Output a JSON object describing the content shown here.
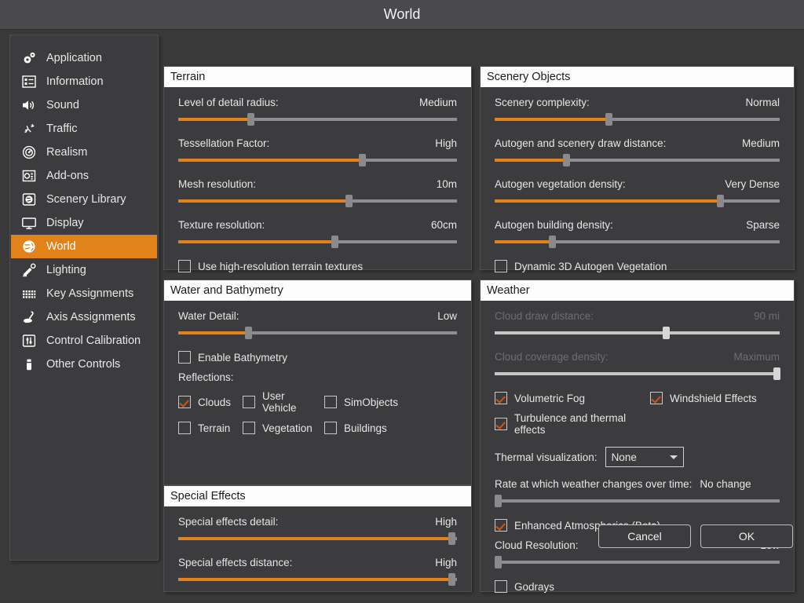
{
  "window": {
    "title": "World"
  },
  "sidebar": {
    "items": [
      {
        "label": "Application",
        "icon": "gears-icon",
        "active": false
      },
      {
        "label": "Information",
        "icon": "list-icon",
        "active": false
      },
      {
        "label": "Sound",
        "icon": "speaker-icon",
        "active": false
      },
      {
        "label": "Traffic",
        "icon": "airplanes-icon",
        "active": false
      },
      {
        "label": "Realism",
        "icon": "gauge-icon",
        "active": false
      },
      {
        "label": "Add-ons",
        "icon": "addons-box-icon",
        "active": false
      },
      {
        "label": "Scenery Library",
        "icon": "globe-box-icon",
        "active": false
      },
      {
        "label": "Display",
        "icon": "monitor-icon",
        "active": false
      },
      {
        "label": "World",
        "icon": "globe-icon",
        "active": true
      },
      {
        "label": "Lighting",
        "icon": "lamp-icon",
        "active": false
      },
      {
        "label": "Key Assignments",
        "icon": "keyboard-icon",
        "active": false
      },
      {
        "label": "Axis Assignments",
        "icon": "joystick-icon",
        "active": false
      },
      {
        "label": "Control Calibration",
        "icon": "sliders-box-icon",
        "active": false
      },
      {
        "label": "Other Controls",
        "icon": "device-icon",
        "active": false
      }
    ]
  },
  "terrain": {
    "title": "Terrain",
    "sliders": [
      {
        "label": "Level of detail radius:",
        "value": "Medium",
        "pct": 26
      },
      {
        "label": "Tessellation Factor:",
        "value": "High",
        "pct": 66
      },
      {
        "label": "Mesh resolution:",
        "value": "10m",
        "pct": 61
      },
      {
        "label": "Texture resolution:",
        "value": "60cm",
        "pct": 56
      }
    ],
    "checkbox": {
      "label": "Use high-resolution terrain textures",
      "checked": false
    }
  },
  "scenery": {
    "title": "Scenery Objects",
    "sliders": [
      {
        "label": "Scenery complexity:",
        "value": "Normal",
        "pct": 40
      },
      {
        "label": "Autogen and scenery draw distance:",
        "value": "Medium",
        "pct": 25
      },
      {
        "label": "Autogen vegetation density:",
        "value": "Very Dense",
        "pct": 79
      },
      {
        "label": "Autogen building density:",
        "value": "Sparse",
        "pct": 20
      }
    ],
    "checkbox": {
      "label": "Dynamic 3D Autogen Vegetation",
      "checked": false
    }
  },
  "water": {
    "title": "Water and Bathymetry",
    "slider": {
      "label": "Water Detail:",
      "value": "Low",
      "pct": 25
    },
    "bathymetry": {
      "label": "Enable Bathymetry",
      "checked": false
    },
    "reflections_label": "Reflections:",
    "reflections": [
      {
        "label": "Clouds",
        "checked": true
      },
      {
        "label": "User Vehicle",
        "checked": false
      },
      {
        "label": "SimObjects",
        "checked": false
      },
      {
        "label": "Terrain",
        "checked": false
      },
      {
        "label": "Vegetation",
        "checked": false
      },
      {
        "label": "Buildings",
        "checked": false
      }
    ]
  },
  "special_effects": {
    "title": "Special Effects",
    "sliders": [
      {
        "label": "Special effects detail:",
        "value": "High",
        "pct": 98
      },
      {
        "label": "Special effects distance:",
        "value": "High",
        "pct": 98
      }
    ]
  },
  "weather": {
    "title": "Weather",
    "cloud_draw": {
      "label": "Cloud draw distance:",
      "value": "90 mi",
      "pct": 60,
      "disabled": true
    },
    "cloud_coverage": {
      "label": "Cloud coverage density:",
      "value": "Maximum",
      "pct": 99,
      "disabled": true
    },
    "checks": [
      {
        "label": "Volumetric Fog",
        "checked": true
      },
      {
        "label": "Windshield Effects",
        "checked": true
      },
      {
        "label": "Turbulence and thermal effects",
        "checked": true
      }
    ],
    "thermal": {
      "label": "Thermal visualization:",
      "value": "None"
    },
    "weather_rate": {
      "label": "Rate at which weather changes over time:",
      "value": "No change",
      "pct": 1
    },
    "enhanced_atmos": {
      "label": "Enhanced Atmospherics (Beta)",
      "checked": true
    },
    "cloud_resolution": {
      "label": "Cloud Resolution:",
      "value": "Low",
      "pct": 1
    },
    "godrays": {
      "label": "Godrays",
      "checked": false
    }
  },
  "footer": {
    "cancel": "Cancel",
    "ok": "OK"
  },
  "colors": {
    "accent": "#e2821b",
    "check": "#d4550f",
    "panel": "#3c3c3e",
    "titlebar": "#4a4a4d"
  }
}
